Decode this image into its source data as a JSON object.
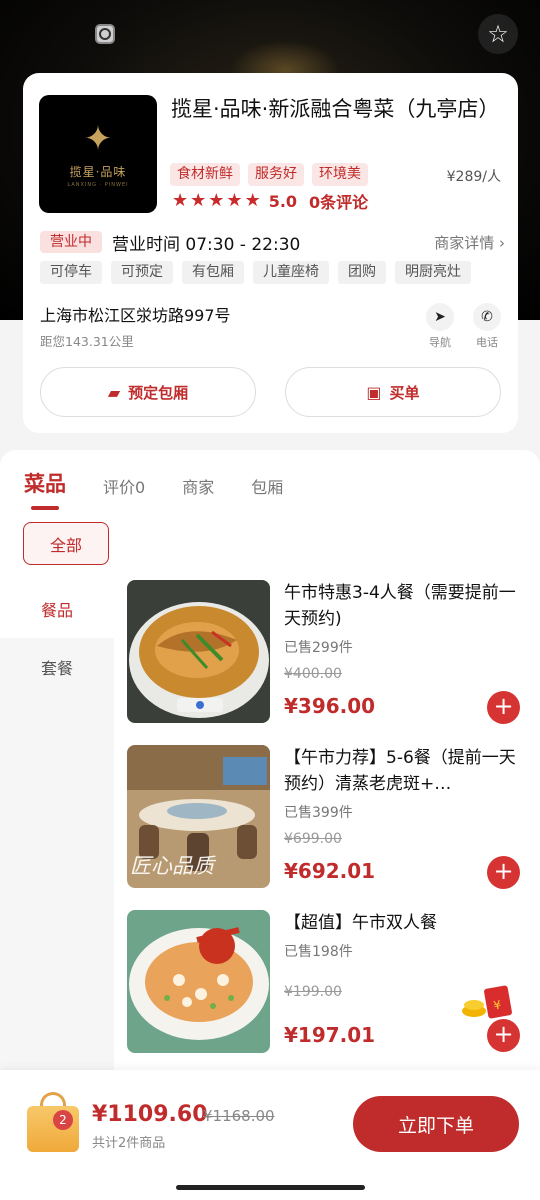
{
  "store": {
    "name": "揽星·品味·新派融合粤菜（九亭店）",
    "logo_text": "揽星·品味",
    "logo_sub": "LANXING · PINWEI",
    "tags": [
      "食材新鲜",
      "服务好",
      "环境美"
    ],
    "per_person": "¥289/人",
    "stars": 5,
    "rating": "5.0",
    "reviews": "0条评论",
    "status": "营业中",
    "hours": "营业时间 07:30 - 22:30",
    "merchant_detail": "商家详情 ›",
    "facilities": [
      "可停车",
      "可预定",
      "有包厢",
      "儿童座椅",
      "团购",
      "明厨亮灶"
    ],
    "address": "上海市松江区泶坊路997号",
    "distance": "距您143.31公里",
    "nav_label": "导航",
    "phone_label": "电话",
    "reserve_label": "预定包厢",
    "pay_label": "买单"
  },
  "tabs": [
    "菜品",
    "评价0",
    "商家",
    "包厢"
  ],
  "filter_all": "全部",
  "side_nav": [
    "餐品",
    "套餐"
  ],
  "products": [
    {
      "title": "午市特惠3-4人餐（需要提前一天预约)",
      "sold": "已售299件",
      "orig": "¥400.00",
      "price": "¥396.00"
    },
    {
      "title": "【午市力荐】5-6餐（提前一天预约）清蒸老虎斑+…",
      "sold": "已售399件",
      "orig": "¥699.00",
      "price": "¥692.01"
    },
    {
      "title": "【超值】午市双人餐",
      "sold": "已售198件",
      "orig": "¥199.00",
      "price": "¥197.01"
    }
  ],
  "image_captions": {
    "p2": "匠心品质"
  },
  "cart": {
    "count": "2",
    "total": "¥1109.60",
    "orig_total": "¥1168.00",
    "item_count": "共计2件商品",
    "order_label": "立即下单"
  },
  "colors": {
    "accent": "#c02b2b",
    "tag_bg": "#fbe6e6"
  }
}
